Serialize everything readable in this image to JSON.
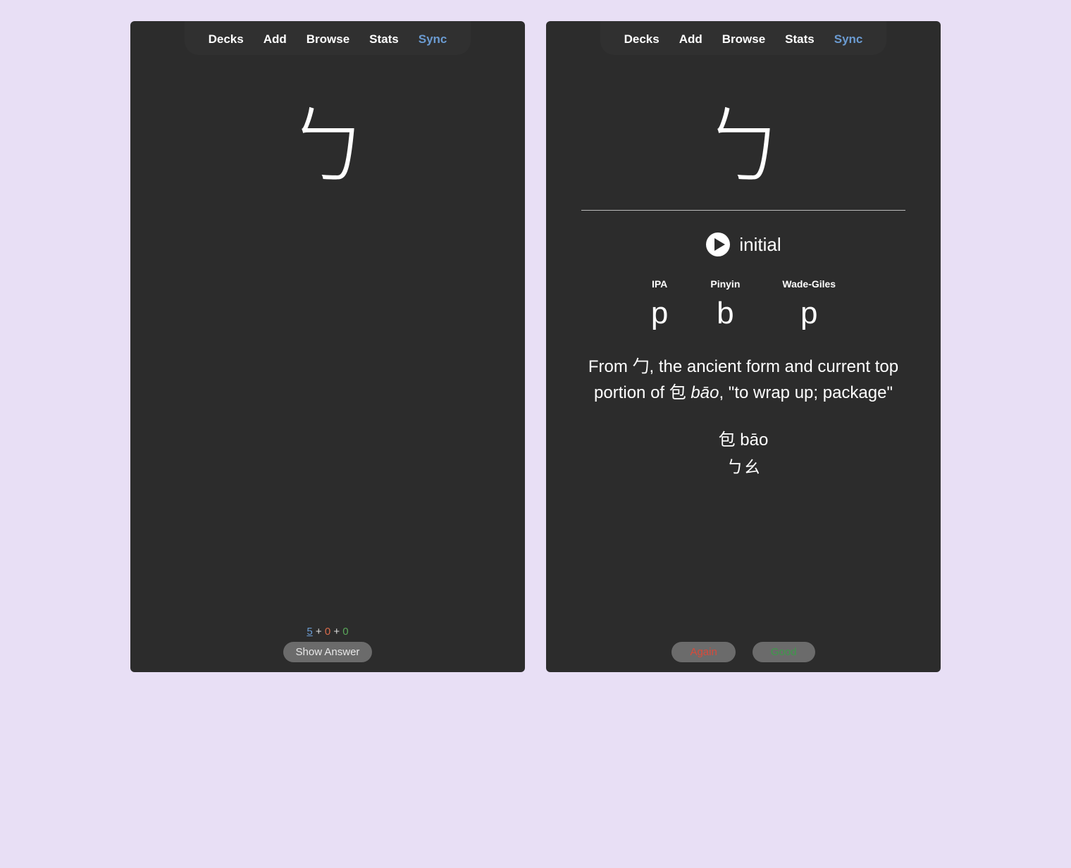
{
  "menu": {
    "items": [
      "Decks",
      "Add",
      "Browse",
      "Stats",
      "Sync"
    ],
    "activeIndex": 4
  },
  "card": {
    "front": {
      "bopomofo": "ㄅ"
    },
    "back": {
      "bopomofo": "ㄅ",
      "playLabel": "initial",
      "phonetics": [
        {
          "system": "IPA",
          "value": "p"
        },
        {
          "system": "Pinyin",
          "value": "b"
        },
        {
          "system": "Wade-Giles",
          "value": "p"
        }
      ],
      "etymology_pre": "From 勹, the ancient form and current top portion of 包 ",
      "etymology_italic": "bāo",
      "etymology_post": ", \"to wrap up; package\"",
      "example_line1": "包 bāo",
      "example_line2": "ㄅㄠ"
    }
  },
  "review": {
    "counts": {
      "new": "5",
      "learn": "0",
      "due": "0"
    },
    "showAnswerLabel": "Show Answer",
    "buttons": {
      "again": "Again",
      "good": "Good"
    }
  }
}
